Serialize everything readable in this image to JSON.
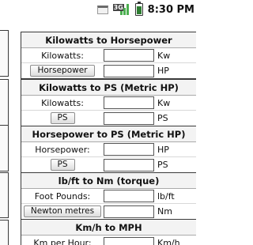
{
  "status_bar": {
    "signal_label": "3G",
    "time": "8:30 PM",
    "battery_level": 0.85
  },
  "panels": [
    {
      "title": "Kilowatts to Horsepower",
      "input_label": "Kilowatts:",
      "input_value": "",
      "input_unit": "Kw",
      "button_label": "Horsepower",
      "output_value": "",
      "output_unit": "HP"
    },
    {
      "title": "Kilowatts to PS (Metric HP)",
      "input_label": "Kilowatts:",
      "input_value": "",
      "input_unit": "Kw",
      "button_label": "PS",
      "output_value": "",
      "output_unit": "PS"
    },
    {
      "title": "Horsepower to PS (Metric HP)",
      "input_label": "Horsepower:",
      "input_value": "",
      "input_unit": "HP",
      "button_label": "PS",
      "output_value": "",
      "output_unit": "PS"
    },
    {
      "title": "lb/ft to Nm (torque)",
      "input_label": "Foot Pounds:",
      "input_value": "",
      "input_unit": "lb/ft",
      "button_label": "Newton metres",
      "output_value": "",
      "output_unit": "Nm"
    },
    {
      "title": "Km/h to MPH",
      "input_label": "Km per Hour:",
      "input_value": "",
      "input_unit": "Km/h"
    }
  ]
}
